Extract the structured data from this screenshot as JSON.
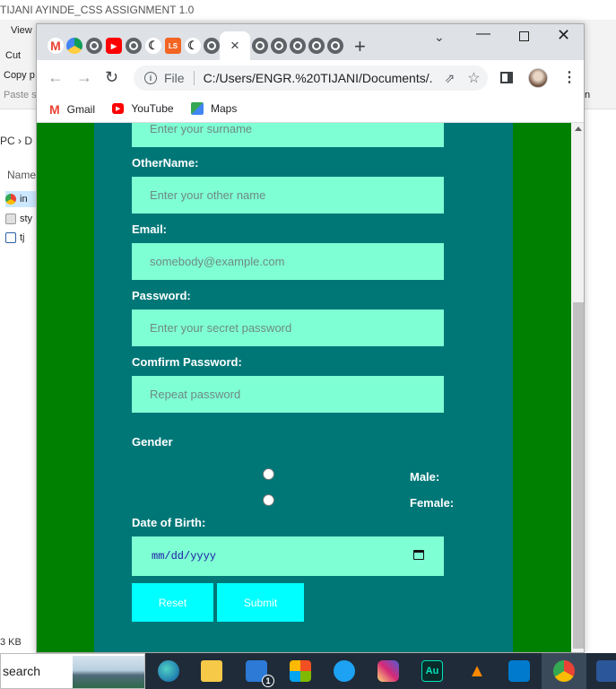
{
  "explorer": {
    "title": "TIJANI AYINDE_CSS ASSIGNMENT 1.0",
    "ribbon": {
      "view": "View",
      "cut": "Cut",
      "copy": "Copy p",
      "paste": "Paste s",
      "edge": "n"
    },
    "breadcrumb": "PC  ›  D",
    "name_header": "Name",
    "files": [
      "in",
      "sty",
      "tj"
    ],
    "status": "3 KB"
  },
  "chrome": {
    "active_tab_close": "×",
    "new_tab": "+",
    "tab_search": "⌄",
    "window": {
      "minimize": "—",
      "maximize": "",
      "close": "✕"
    },
    "omnibox": {
      "scheme": "File",
      "url": "C:/Users/ENGR.%20TIJANI/Documents/..."
    },
    "bookmarks": [
      {
        "label": "Gmail",
        "icon": "gmail-icon",
        "color": "#EA4335"
      },
      {
        "label": "YouTube",
        "icon": "youtube-icon",
        "color": "#FF0000"
      },
      {
        "label": "Maps",
        "icon": "maps-icon",
        "color": "#34A853"
      }
    ]
  },
  "form": {
    "surname": {
      "placeholder": "Enter your surname"
    },
    "othername": {
      "label": "OtherName:",
      "placeholder": "Enter your other name"
    },
    "email": {
      "label": "Email:",
      "placeholder": "somebody@example.com"
    },
    "password": {
      "label": "Password:",
      "placeholder": "Enter your secret password"
    },
    "confirm": {
      "label": "Comfirm Password:",
      "placeholder": "Repeat password"
    },
    "gender": {
      "label": "Gender",
      "options": [
        "Male:",
        "Female:"
      ]
    },
    "dob": {
      "label": "Date of Birth:",
      "placeholder": "mm/dd/yyyy"
    },
    "buttons": {
      "reset": "Reset",
      "submit": "Submit"
    },
    "colors": {
      "page_bg": "#008000",
      "panel_bg": "#007777",
      "input_bg": "#7FFFD4",
      "button_bg": "#00FFFF"
    }
  },
  "taskbar": {
    "search_label": "search",
    "apps": [
      "edge-icon",
      "file-explorer-icon",
      "mail-icon",
      "store-icon",
      "twitter-icon",
      "instagram-icon",
      "audition-icon",
      "vlc-icon",
      "vscode-icon",
      "chrome-icon",
      "word-icon"
    ],
    "mail_badge": "1",
    "audition_label": "Au"
  }
}
